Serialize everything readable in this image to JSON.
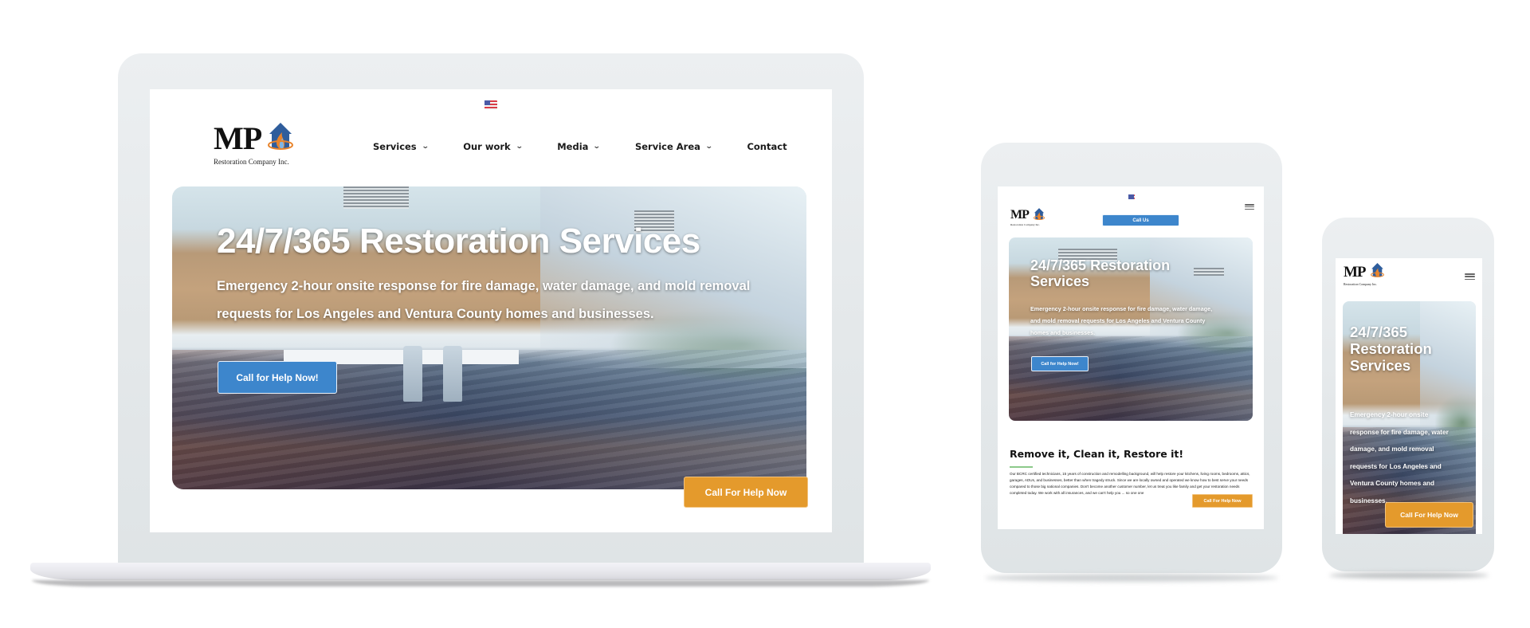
{
  "brand": {
    "logo_text": "MP",
    "logo_tagline": "Restoration Company Inc.",
    "colors": {
      "primary_blue": "#3d86cc",
      "cta_orange": "#e49a2c",
      "accent_green": "#8cc98a",
      "logo_house_blue": "#2f5d9c",
      "logo_flame_orange": "#e8842c"
    }
  },
  "language_flag": "us-flag-icon",
  "desktop": {
    "nav": [
      {
        "label": "Services",
        "has_dropdown": true
      },
      {
        "label": "Our work",
        "has_dropdown": true
      },
      {
        "label": "Media",
        "has_dropdown": true
      },
      {
        "label": "Service Area",
        "has_dropdown": true
      },
      {
        "label": "Contact",
        "has_dropdown": false
      }
    ],
    "hero": {
      "title": "24/7/365 Restoration Services",
      "subtitle_line1": "Emergency 2-hour onsite response for fire damage, water damage, and mold removal",
      "subtitle_line2": "requests for Los Angeles and Ventura County homes and businesses.",
      "cta_label": "Call for Help Now!"
    },
    "floating_cta_label": "Call For Help Now"
  },
  "tablet": {
    "call_us_label": "Call Us",
    "menu_icon": "hamburger-icon",
    "hero": {
      "title_line1": "24/7/365 Restoration",
      "title_line2": "Services",
      "subtitle_line1": "Emergency 2-hour onsite response for fire damage, water damage,",
      "subtitle_line2": "and mold removal requests for Los Angeles and Ventura County",
      "subtitle_line3": "homes and businesses.",
      "cta_label": "Call for Help Now!"
    },
    "section": {
      "title": "Remove it, Clean it, Restore it!",
      "body": "Our BCRC certified technicians, 15 years of construction and remodelling background, will help restore your kitchens, living rooms, bedrooms, attics, garages, ADUs, and businesses, better than when tragedy struck. Since we are locally owned and operated we know how to best serve your needs compared to those big national companies. Don't become another customer number, let us treat you like family and get your restoration needs completed today. We work with all insurances, and we can't help you ... so one one"
    },
    "floating_cta_label": "Call For Help Now"
  },
  "mobile": {
    "menu_icon": "hamburger-icon",
    "hero": {
      "title_line1": "24/7/365",
      "title_line2": "Restoration",
      "title_line3": "Services",
      "subtitle_lines": [
        "Emergency 2-hour onsite",
        "response for fire damage, water",
        "damage, and mold removal",
        "requests for Los Angeles and",
        "Ventura County homes and",
        "businesses."
      ]
    },
    "floating_cta_label": "Call For Help Now"
  }
}
